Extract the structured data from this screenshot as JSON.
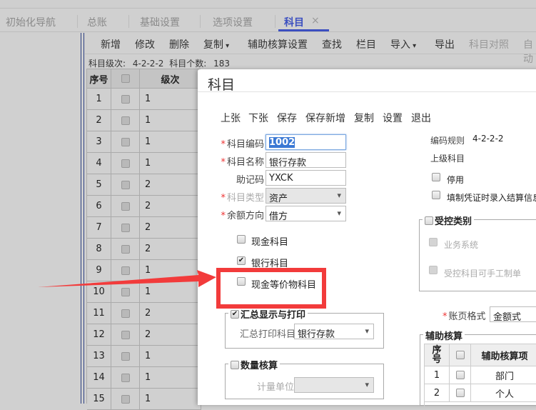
{
  "tabs": [
    {
      "label": "初始化导航"
    },
    {
      "label": "总账"
    },
    {
      "label": "基础设置"
    },
    {
      "label": "选项设置"
    },
    {
      "label": "科目",
      "active": true
    }
  ],
  "tab_close": "×",
  "toolbar": [
    {
      "label": "新增"
    },
    {
      "label": "修改"
    },
    {
      "label": "删除"
    },
    {
      "label": "复制",
      "dropdown": true
    },
    {
      "label": "辅助核算设置"
    },
    {
      "label": "查找"
    },
    {
      "label": "栏目"
    },
    {
      "label": "导入",
      "dropdown": true
    },
    {
      "label": "导出"
    },
    {
      "label": "科目对照",
      "disabled": true
    },
    {
      "label": "自动",
      "disabled": true
    }
  ],
  "info": {
    "level_label": "科目级次:",
    "level_value": "4-2-2-2",
    "count_label": "科目个数:",
    "count_value": "183"
  },
  "grid": {
    "headers": [
      "序号",
      "",
      "级次"
    ],
    "rows": [
      [
        "1",
        "1"
      ],
      [
        "2",
        "1"
      ],
      [
        "3",
        "1"
      ],
      [
        "4",
        "1"
      ],
      [
        "5",
        "2"
      ],
      [
        "6",
        "2"
      ],
      [
        "7",
        "2"
      ],
      [
        "8",
        "2"
      ],
      [
        "9",
        "1"
      ],
      [
        "10",
        "1"
      ],
      [
        "11",
        "2"
      ],
      [
        "12",
        "2"
      ],
      [
        "13",
        "1"
      ],
      [
        "14",
        "1"
      ],
      [
        "15",
        "1"
      ]
    ]
  },
  "dialog": {
    "title": "科目",
    "toolbar": [
      "上张",
      "下张",
      "保存",
      "保存新增",
      "复制",
      "设置",
      "退出"
    ],
    "fields": {
      "code": {
        "label": "科目编码",
        "value": "1002",
        "required": true
      },
      "name": {
        "label": "科目名称",
        "value": "银行存款",
        "required": true
      },
      "mnemonic": {
        "label": "助记码",
        "value": "YXCK"
      },
      "type": {
        "label": "科目类型",
        "value": "资产",
        "required": true,
        "disabled": true
      },
      "direction": {
        "label": "余额方向",
        "value": "借方",
        "required": true
      }
    },
    "checks": [
      {
        "label": "现金科目",
        "checked": false
      },
      {
        "label": "银行科目",
        "checked": true
      },
      {
        "label": "现金等价物科目",
        "checked": false
      }
    ],
    "summary": {
      "legend": "汇总显示与打印",
      "checked": true,
      "print_label": "汇总打印科目",
      "print_value": "银行存款"
    },
    "quantity": {
      "legend": "数量核算",
      "checked": false,
      "unit_label": "计量单位",
      "unit_value": ""
    },
    "right": {
      "rule_label": "编码规则",
      "rule_value": "4-2-2-2",
      "parent_label": "上级科目",
      "disable_label": "停用",
      "settle_label": "填制凭证时录入结算信息"
    },
    "controlled": {
      "legend": "受控类别",
      "items": [
        "业务系统",
        "受控科目可手工制单"
      ]
    },
    "ledger": {
      "label": "账页格式",
      "value": "金额式"
    },
    "aux": {
      "legend": "辅助核算",
      "headers": [
        "序号",
        "",
        "辅助核算项"
      ],
      "rows": [
        [
          "1",
          "部门"
        ],
        [
          "2",
          "个人"
        ]
      ]
    }
  },
  "annotation_color": "#f23b3b"
}
